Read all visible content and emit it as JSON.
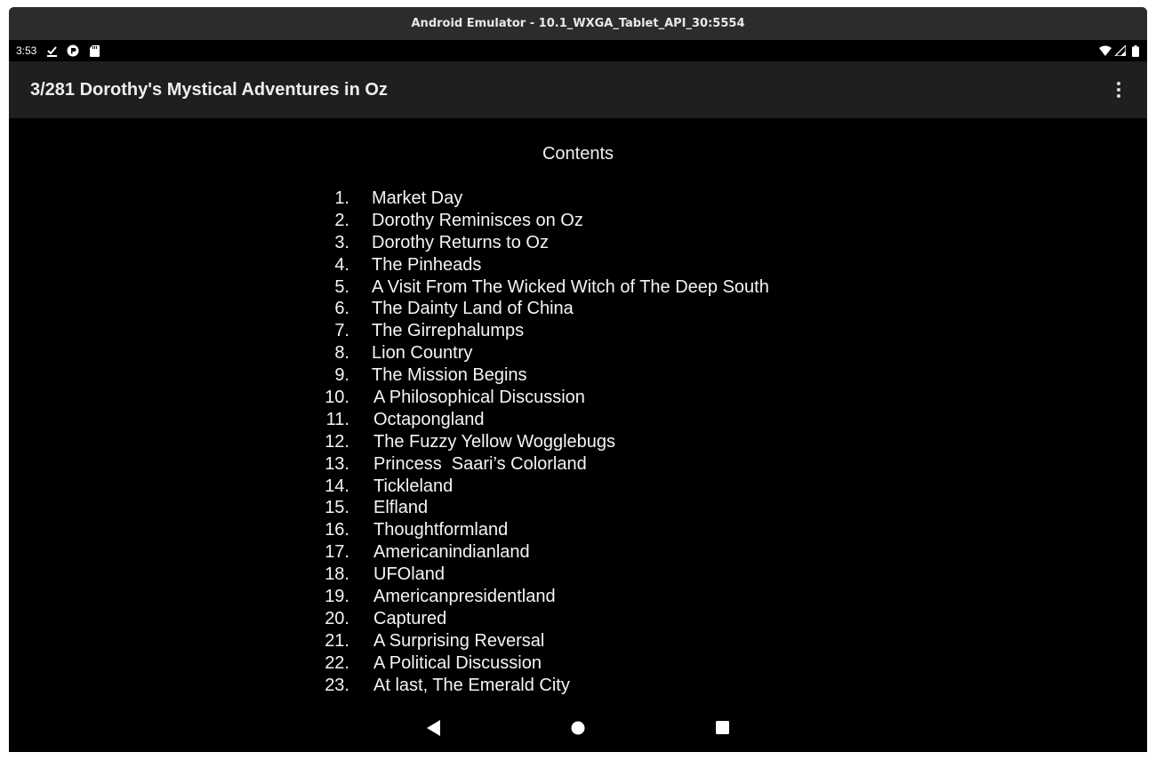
{
  "window": {
    "title": "Android Emulator - 10.1_WXGA_Tablet_API_30:5554"
  },
  "statusbar": {
    "time": "3:53",
    "left_icons": [
      "download-done-icon",
      "app-notification-icon",
      "sd-card-icon"
    ],
    "right_icons": [
      "wifi-icon",
      "cellular-signal-icon",
      "battery-icon"
    ]
  },
  "appbar": {
    "title": "3/281 Dorothy's Mystical Adventures in Oz",
    "menu_icon": "more-vert-icon"
  },
  "content": {
    "heading": "Contents",
    "items": [
      {
        "num": "1.",
        "label": "Market Day"
      },
      {
        "num": "2.",
        "label": "Dorothy Reminisces on Oz"
      },
      {
        "num": "3.",
        "label": "Dorothy Returns to Oz"
      },
      {
        "num": "4.",
        "label": "The Pinheads"
      },
      {
        "num": "5.",
        "label": "A Visit From The Wicked Witch of The Deep South"
      },
      {
        "num": "6.",
        "label": "The Dainty Land of China"
      },
      {
        "num": "7.",
        "label": "The Girrephalumps"
      },
      {
        "num": "8.",
        "label": "Lion Country"
      },
      {
        "num": "9.",
        "label": "The Mission Begins"
      },
      {
        "num": "10.",
        "label": "A Philosophical Discussion"
      },
      {
        "num": "11.",
        "label": "Octapongland"
      },
      {
        "num": "12.",
        "label": "The Fuzzy Yellow Wogglebugs"
      },
      {
        "num": "13.",
        "label": "Princess  Saari’s Colorland"
      },
      {
        "num": "14.",
        "label": "Tickleland"
      },
      {
        "num": "15.",
        "label": "Elfland"
      },
      {
        "num": "16.",
        "label": "Thoughtformland"
      },
      {
        "num": "17.",
        "label": "Americanindianland"
      },
      {
        "num": "18.",
        "label": "UFOland"
      },
      {
        "num": "19.",
        "label": "Americanpresidentland"
      },
      {
        "num": "20.",
        "label": "Captured"
      },
      {
        "num": "21.",
        "label": "A Surprising Reversal"
      },
      {
        "num": "22.",
        "label": "A Political Discussion"
      },
      {
        "num": "23.",
        "label": "At last, The Emerald City"
      }
    ]
  },
  "navbar": {
    "icons": [
      "back-icon",
      "home-icon",
      "recents-icon"
    ]
  }
}
